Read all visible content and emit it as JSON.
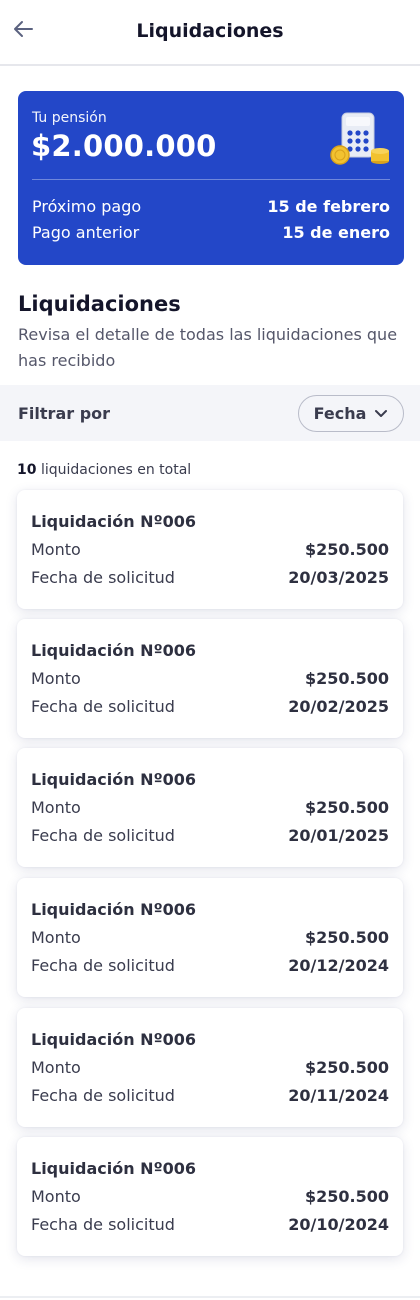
{
  "header": {
    "title": "Liquidaciones",
    "back_icon": "arrow-left-icon"
  },
  "pension": {
    "label": "Tu pensión",
    "amount": "$2.000.000",
    "illustration": "calculator-coins-icon",
    "next_payment_label": "Próximo pago",
    "next_payment_value": "15 de febrero",
    "prev_payment_label": "Pago anterior",
    "prev_payment_value": "15 de enero",
    "color": "#2347c8"
  },
  "section": {
    "title": "Liquidaciones",
    "description": "Revisa el detalle de todas las liquidaciones que has recibido"
  },
  "filter": {
    "label": "Filtrar por",
    "selected": "Fecha",
    "icon": "chevron-down-icon"
  },
  "summary": {
    "count": "10",
    "text": "liquidaciones en total"
  },
  "settlements": [
    {
      "title": "Liquidación Nº006",
      "amount_label": "Monto",
      "amount": "$250.500",
      "date_label": "Fecha de solicitud",
      "date": "20/03/2025"
    },
    {
      "title": "Liquidación Nº006",
      "amount_label": "Monto",
      "amount": "$250.500",
      "date_label": "Fecha de solicitud",
      "date": "20/02/2025"
    },
    {
      "title": "Liquidación Nº006",
      "amount_label": "Monto",
      "amount": "$250.500",
      "date_label": "Fecha de solicitud",
      "date": "20/01/2025"
    },
    {
      "title": "Liquidación Nº006",
      "amount_label": "Monto",
      "amount": "$250.500",
      "date_label": "Fecha de solicitud",
      "date": "20/12/2024"
    },
    {
      "title": "Liquidación Nº006",
      "amount_label": "Monto",
      "amount": "$250.500",
      "date_label": "Fecha de solicitud",
      "date": "20/11/2024"
    },
    {
      "title": "Liquidación Nº006",
      "amount_label": "Monto",
      "amount": "$250.500",
      "date_label": "Fecha de solicitud",
      "date": "20/10/2024"
    }
  ]
}
